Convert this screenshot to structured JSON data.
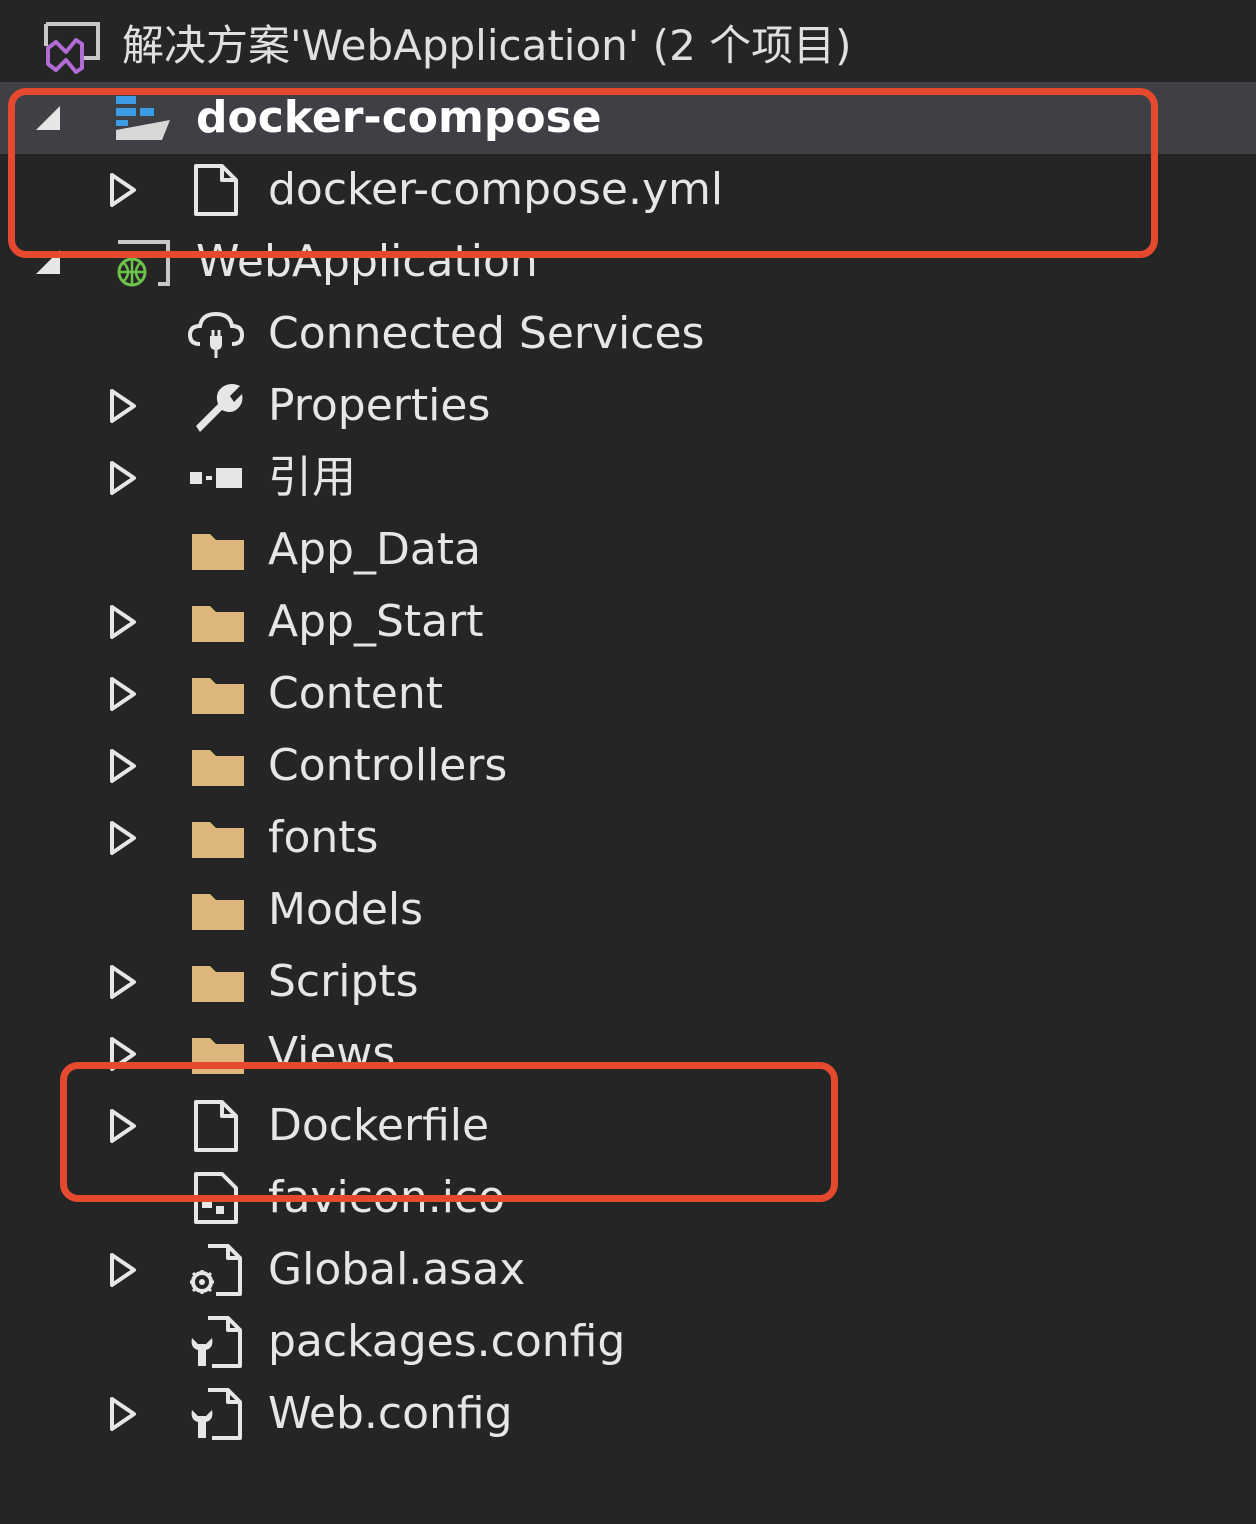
{
  "solution": {
    "title": "解决方案'WebApplication' (2 个项目)",
    "icon": "visual-studio-solution-icon"
  },
  "tree": {
    "compose_project": {
      "label": "docker-compose",
      "icon": "docker-compose-project-icon",
      "expanded": true,
      "selected": true
    },
    "compose_yml": {
      "label": "docker-compose.yml",
      "icon": "file-icon"
    },
    "web_project": {
      "label": "WebApplication",
      "icon": "web-project-icon",
      "expanded": true
    },
    "items": [
      {
        "label": "Connected Services",
        "icon": "connected-services-icon",
        "expandable": false
      },
      {
        "label": "Properties",
        "icon": "wrench-icon",
        "expandable": true
      },
      {
        "label": "引用",
        "icon": "references-icon",
        "expandable": true
      },
      {
        "label": "App_Data",
        "icon": "folder-icon",
        "expandable": false
      },
      {
        "label": "App_Start",
        "icon": "folder-icon",
        "expandable": true
      },
      {
        "label": "Content",
        "icon": "folder-icon",
        "expandable": true
      },
      {
        "label": "Controllers",
        "icon": "folder-icon",
        "expandable": true
      },
      {
        "label": "fonts",
        "icon": "folder-icon",
        "expandable": true
      },
      {
        "label": "Models",
        "icon": "folder-icon",
        "expandable": false
      },
      {
        "label": "Scripts",
        "icon": "folder-icon",
        "expandable": true
      },
      {
        "label": "Views",
        "icon": "folder-icon",
        "expandable": true
      },
      {
        "label": "Dockerfile",
        "icon": "file-icon",
        "expandable": true
      },
      {
        "label": "favicon.ico",
        "icon": "image-file-icon",
        "expandable": false
      },
      {
        "label": "Global.asax",
        "icon": "gear-file-icon",
        "expandable": true
      },
      {
        "label": "packages.config",
        "icon": "config-file-icon",
        "expandable": false
      },
      {
        "label": "Web.config",
        "icon": "config-file-icon",
        "expandable": true
      }
    ]
  },
  "colors": {
    "background": "#252526",
    "selected_row": "#3f3f46",
    "highlight": "#e64a2e",
    "folder": "#dcb67a",
    "text": "#e6e6e6"
  }
}
